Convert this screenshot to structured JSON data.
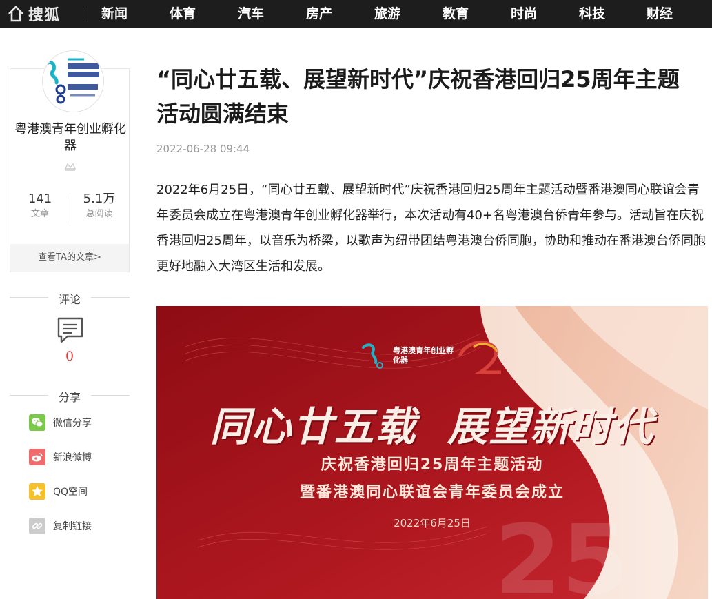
{
  "nav": {
    "logo": "搜狐",
    "items": [
      "新闻",
      "体育",
      "汽车",
      "房产",
      "旅游",
      "教育",
      "时尚",
      "科技",
      "财经"
    ]
  },
  "author": {
    "name": "粤港澳青年创业孵化器",
    "articles_count": "141",
    "articles_label": "文章",
    "reads_count": "5.1万",
    "reads_label": "总阅读",
    "view_articles": "查看TA的文章>"
  },
  "comments": {
    "title": "评论",
    "count": "0"
  },
  "share": {
    "title": "分享",
    "items": [
      {
        "label": "微信分享",
        "icon": "wechat-icon",
        "color": "#7bc94a"
      },
      {
        "label": "新浪微博",
        "icon": "weibo-icon",
        "color": "#f06b6b"
      },
      {
        "label": "QQ空间",
        "icon": "qzone-icon",
        "color": "#f5c02a"
      },
      {
        "label": "复制链接",
        "icon": "link-icon",
        "color": "#cccccc"
      }
    ]
  },
  "article": {
    "title": "“同心廿五载、展望新时代”庆祝香港回归25周年主题活动圆满结束",
    "time": "2022-06-28 09:44",
    "body": "2022年6月25日，“同心廿五载、展望新时代”庆祝香港回归25周年主题活动暨番港澳同心联谊会青年委员会成立在粤港澳青年创业孵化器举行，本次活动有40+名粤港澳台侨青年参与。活动旨在庆祝香港回归25周年，以音乐为桥梁，以歌声为纽带团结粤港澳台侨同胞，协助和推动在番港澳台侨同胞更好地融入大湾区生活和发展。"
  },
  "banner": {
    "headline": "同心廿五载  展望新时代",
    "subline1": "庆祝香港回归25周年主题活动",
    "subline2": "暨番港澳同心联谊会青年委员会成立",
    "date": "2022年6月25日",
    "logo_text": "粤港澳青年创业孵化器",
    "big_number": "25"
  },
  "colors": {
    "nav_bg": "#1d1d1d",
    "banner_red": "#a3141c",
    "accent_red": "#e03b3b"
  }
}
